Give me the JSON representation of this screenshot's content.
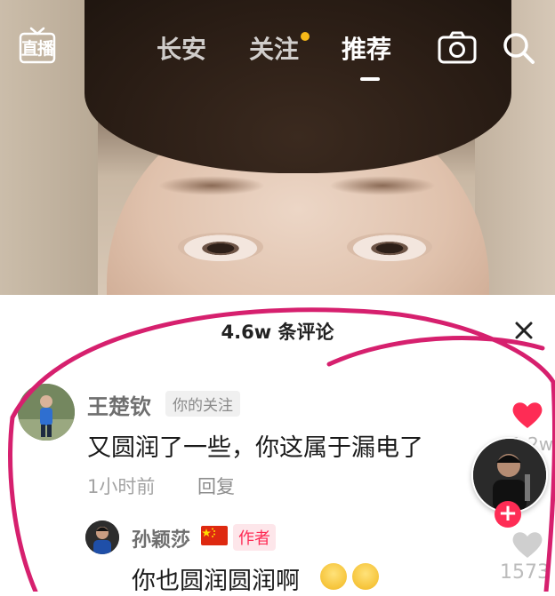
{
  "topbar": {
    "live_label": "直播",
    "tabs": [
      {
        "label": "长安"
      },
      {
        "label": "关注"
      },
      {
        "label": "推荐"
      }
    ],
    "icons": {
      "camera": "camera-icon",
      "search": "search-icon"
    }
  },
  "comments_sheet": {
    "count_label": "4.6w 条评论",
    "comments": [
      {
        "username": "王楚钦",
        "tag": "你的关注",
        "text": "又圆润了一些，你这属于漏电了",
        "time": "1小时前",
        "reply_label": "回复",
        "likes": "1.2w"
      },
      {
        "username": "孙颖莎",
        "tag": "作者",
        "text": "你也圆润圆润啊",
        "likes": "1573"
      }
    ]
  },
  "colors": {
    "accent": "#fe2c55",
    "notification_dot": "#f6b818",
    "annotation": "#d6206e"
  }
}
